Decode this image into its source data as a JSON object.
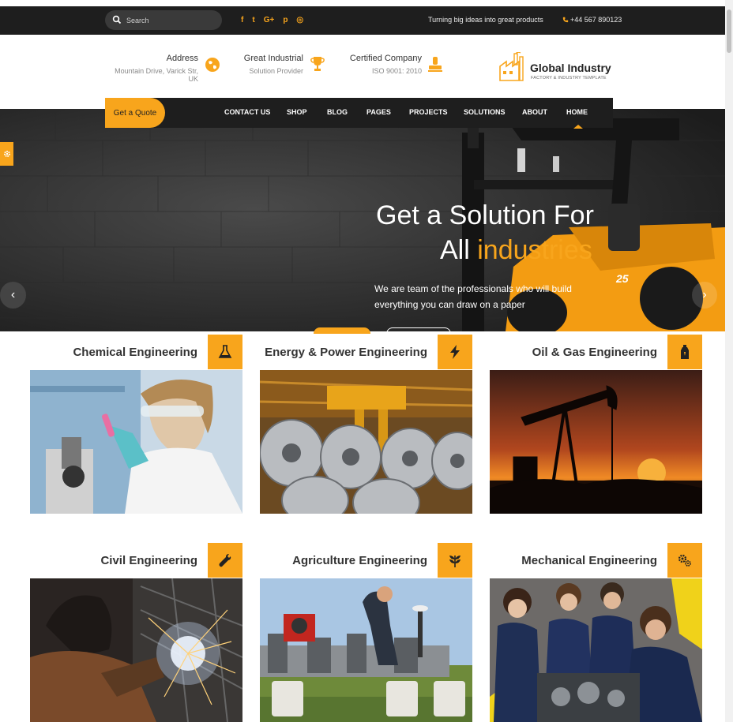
{
  "topbar": {
    "search_placeholder": "Search",
    "social_icons": [
      {
        "name": "facebook-icon",
        "glyph": "f"
      },
      {
        "name": "twitter-icon",
        "glyph": "t"
      },
      {
        "name": "google-plus-icon",
        "glyph": "G+"
      },
      {
        "name": "pinterest-icon",
        "glyph": "p"
      },
      {
        "name": "dribbble-icon",
        "glyph": "◎"
      }
    ],
    "tagline": "Turning big ideas into great products",
    "phone": "+44 567 890123"
  },
  "header": {
    "address_title": "Address",
    "address_sub": "Mountain Drive, Varick Str, UK",
    "industrial_title": "Great Industrial",
    "industrial_sub": "Solution Provider",
    "certified_title": "Certified Company",
    "certified_sub": "ISO 9001: 2010",
    "logo_name": "Global Industry",
    "logo_sub": "FACTORY & INDUSTRY TEMPLATE"
  },
  "nav": {
    "quote_label": "Get a Quote",
    "items": [
      "CONTACT US",
      "SHOP",
      "BLOG",
      "PAGES",
      "PROJECTS",
      "SOLUTIONS",
      "ABOUT",
      "HOME"
    ],
    "active": "HOME"
  },
  "hero": {
    "title_line1": "Get a Solution For",
    "title_line2_white": "All",
    "title_line2_accent": "industries",
    "description": "We are team of the professionals who will build everything you can draw on a paper",
    "prev_icon": "‹",
    "next_icon": "›"
  },
  "services": [
    {
      "title": "Chemical Engineering",
      "icon": "flask-icon"
    },
    {
      "title": "Energy & Power Engineering",
      "icon": "bolt-icon"
    },
    {
      "title": "Oil & Gas Engineering",
      "icon": "fuel-icon"
    },
    {
      "title": "Civil Engineering",
      "icon": "wrench-icon"
    },
    {
      "title": "Agriculture Engineering",
      "icon": "leaf-icon"
    },
    {
      "title": "Mechanical Engineering",
      "icon": "gears-icon"
    }
  ],
  "colors": {
    "accent": "#f8a51c",
    "dark": "#1e1e1e"
  }
}
